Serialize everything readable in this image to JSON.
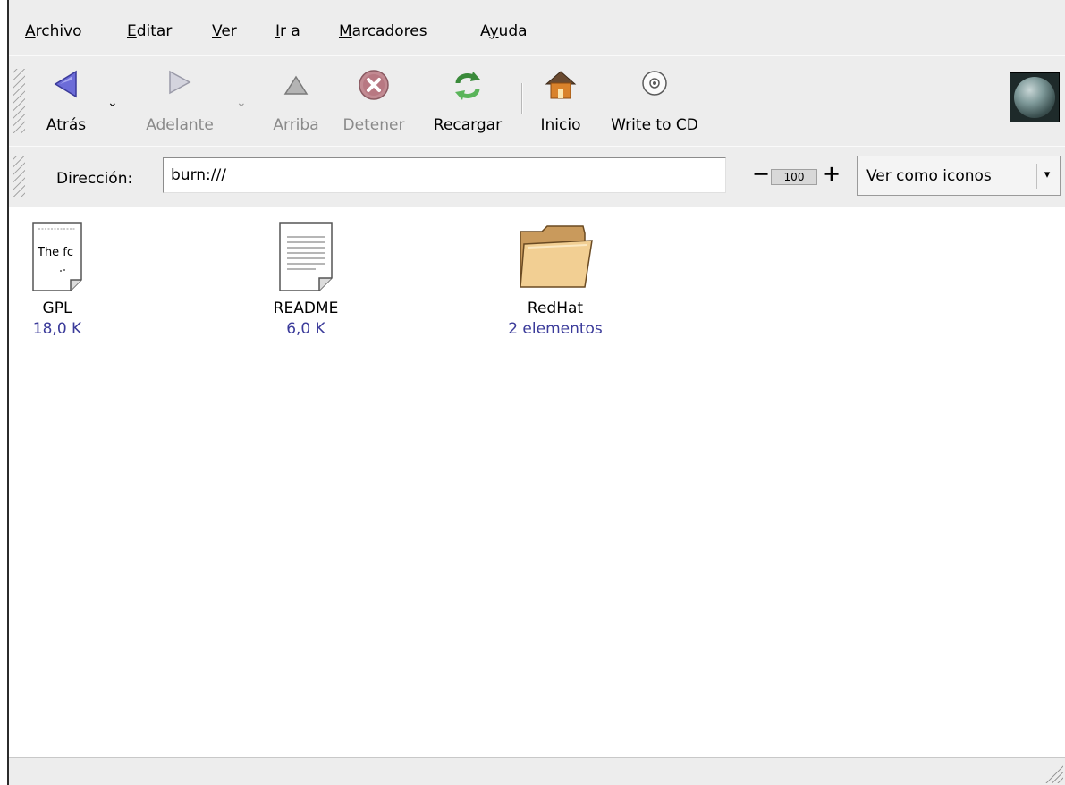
{
  "menubar": {
    "items": [
      {
        "prefix": "",
        "mnemonic": "A",
        "rest": "rchivo"
      },
      {
        "prefix": "",
        "mnemonic": "E",
        "rest": "ditar"
      },
      {
        "prefix": "",
        "mnemonic": "V",
        "rest": "er"
      },
      {
        "prefix": "",
        "mnemonic": "I",
        "rest": "r a"
      },
      {
        "prefix": "",
        "mnemonic": "M",
        "rest": "arcadores"
      },
      {
        "prefix": "A",
        "mnemonic": "y",
        "rest": "uda"
      }
    ]
  },
  "toolbar": {
    "back_label": "Atrás",
    "forward_label": "Adelante",
    "up_label": "Arriba",
    "stop_label": "Detener",
    "reload_label": "Recargar",
    "home_label": "Inicio",
    "write_cd_label": "Write to CD",
    "dropdown_glyph": "⌄"
  },
  "location": {
    "label": "Dirección:",
    "value": "burn:///",
    "zoom_minus": "−",
    "zoom_value": "100",
    "zoom_plus": "+",
    "view_as": "Ver como iconos",
    "view_arrow": "▾"
  },
  "files": [
    {
      "name": "GPL",
      "info": "18,0 K",
      "thumb_text": "The fc",
      "type": "text-preview"
    },
    {
      "name": "README",
      "info": "6,0 K",
      "type": "text-document"
    },
    {
      "name": "RedHat",
      "info": "2 elementos",
      "type": "folder"
    }
  ],
  "colors": {
    "window_bg": "#ededed",
    "content_bg": "#ffffff",
    "info_text": "#3b3b9a",
    "back_arrow": "#6c6cd8"
  }
}
